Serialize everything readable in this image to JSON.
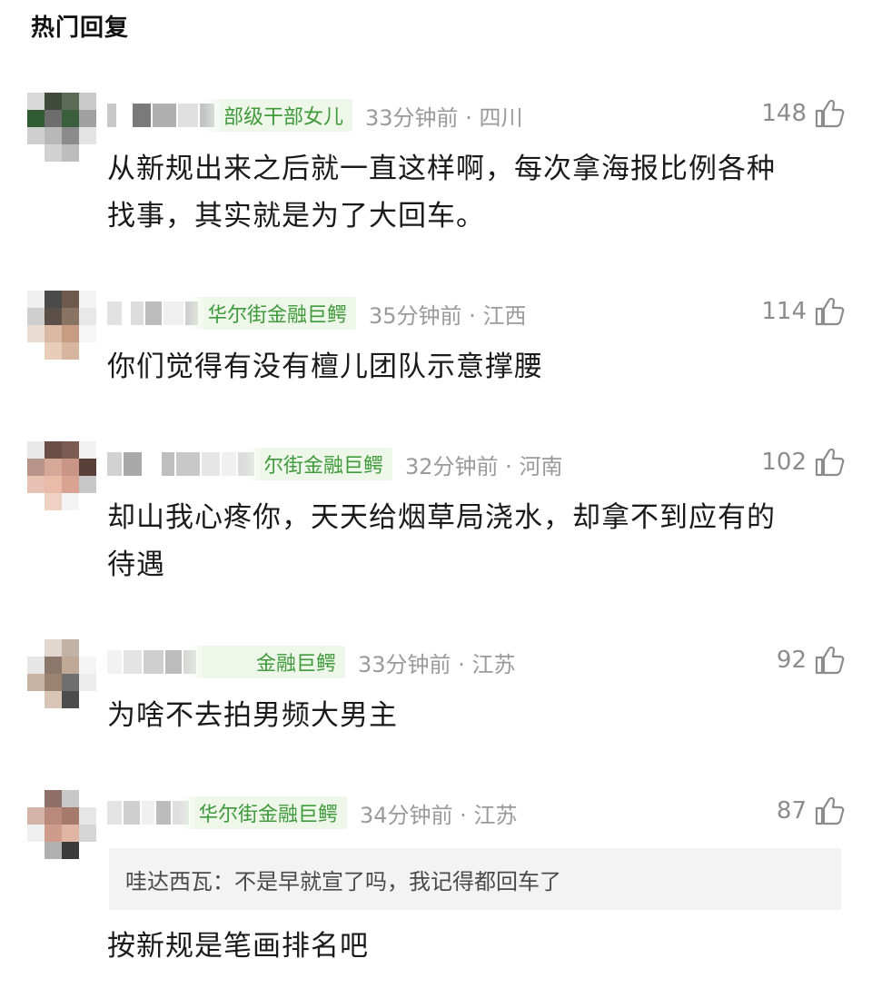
{
  "section_title": "热门回复",
  "comments": [
    {
      "badge": "部级干部女儿",
      "time_loc": "33分钟前 · 四川",
      "likes": "148",
      "lines": [
        "从新规出来之后就一直这样啊，每次拿海报比例各种",
        "找事，其实就是为了大回车。"
      ]
    },
    {
      "badge": "华尔街金融巨鳄",
      "time_loc": "35分钟前 · 江西",
      "likes": "114",
      "lines": [
        "你们觉得有没有檀儿团队示意撑腰"
      ]
    },
    {
      "badge": "尔街金融巨鳄",
      "time_loc": "32分钟前 · 河南",
      "likes": "102",
      "lines": [
        "却山我心疼你，天天给烟草局浇水，却拿不到应有的",
        "待遇"
      ]
    },
    {
      "badge": "金融巨鳄",
      "time_loc": "33分钟前 · 江苏",
      "likes": "92",
      "lines": [
        "为啥不去拍男频大男主"
      ]
    },
    {
      "badge": "华尔街金融巨鳄",
      "time_loc": "34分钟前 · 江苏",
      "likes": "87",
      "reply_name": "哇达西瓦：",
      "reply_text": "不是早就宣了吗，我记得都回车了",
      "lines": [
        "按新规是笔画排名吧"
      ]
    }
  ],
  "icons": {
    "like": "thumbs-up-icon",
    "avatar": "pixelated-avatar"
  },
  "colors": {
    "badge_bg": "#eef7ea",
    "badge_text": "#3e9a3a",
    "meta_text": "#9a9a9a",
    "reply_bg": "#f3f3f3"
  }
}
